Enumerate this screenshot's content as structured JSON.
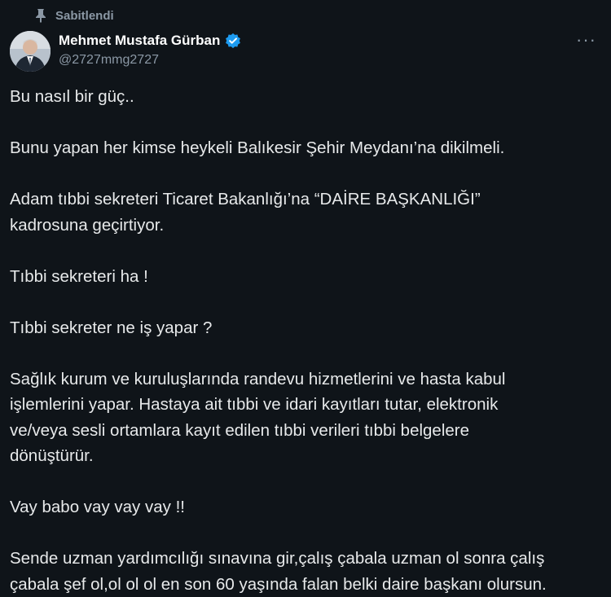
{
  "pinned_label": "Sabitlendi",
  "author": {
    "name": "Mehmet Mustafa Gürban",
    "handle": "@2727mmg2727",
    "verified_color": "#1d9bf0"
  },
  "more_label": "···",
  "icons": {
    "pinned": "pin-icon",
    "verified": "verified-badge-icon",
    "more": "more-options-icon"
  },
  "tweet": {
    "paragraphs": [
      "Bu nasıl bir güç..",
      "Bunu yapan her kimse heykeli Balıkesir Şehir Meydanı’na dikilmeli.",
      "Adam tıbbi sekreteri Ticaret Bakanlığı’na “DAİRE BAŞKANLIĞI”\nkadrosuna geçirtiyor.",
      "Tıbbi sekreteri ha !",
      "Tıbbi sekreter ne iş yapar ?",
      "Sağlık kurum ve kuruluşlarında randevu hizmetlerini ve hasta kabul\nişlemlerini yapar. Hastaya ait tıbbi ve idari kayıtları tutar, elektronik\nve/veya sesli ortamlara kayıt edilen tıbbi verileri tıbbi belgelere\ndönüştürür.",
      "Vay babo vay vay vay !!",
      "Sende uzman yardımcılığı sınavına gir,çalış çabala uzman ol sonra çalış\nçabala şef ol,ol ol ol en son 60 yaşında falan belki daire başkanı olursun."
    ]
  }
}
